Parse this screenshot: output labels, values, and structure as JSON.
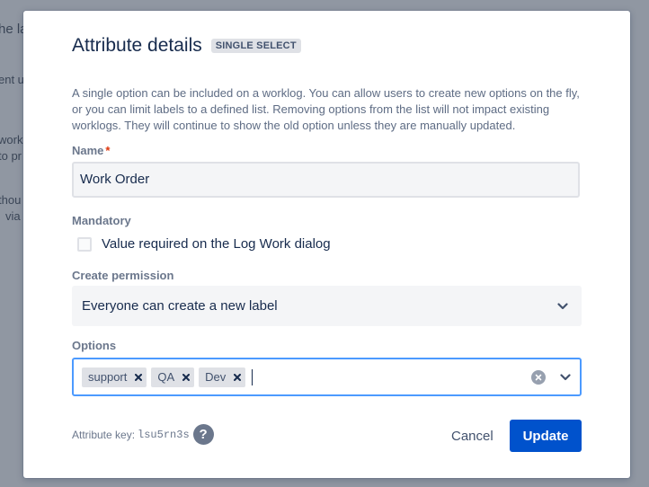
{
  "background": {
    "fragments": [
      "he la",
      "ent u",
      "work",
      "to pr",
      "thou",
      "via"
    ]
  },
  "dialog": {
    "title": "Attribute details",
    "type_badge": "SINGLE SELECT",
    "description": "A single option can be included on a worklog. You can allow users to create new options on the fly, or you can limit labels to a defined list. Removing options from the list will not impact existing worklogs. They will continue to show the old option unless they are manually updated.",
    "name": {
      "label": "Name",
      "required_marker": "*",
      "value": "Work Order"
    },
    "mandatory": {
      "label": "Mandatory",
      "checkbox_label": "Value required on the Log Work dialog",
      "checked": false
    },
    "create_permission": {
      "label": "Create permission",
      "selected": "Everyone can create a new label"
    },
    "options": {
      "label": "Options",
      "tags": [
        "support",
        "QA",
        "Dev"
      ]
    },
    "attribute_key": {
      "label": "Attribute key:",
      "value": "lsu5rn3s"
    },
    "buttons": {
      "cancel": "Cancel",
      "update": "Update"
    }
  },
  "colors": {
    "primary": "#0052cc",
    "focus_border": "#4c9aff",
    "required": "#de350b"
  }
}
